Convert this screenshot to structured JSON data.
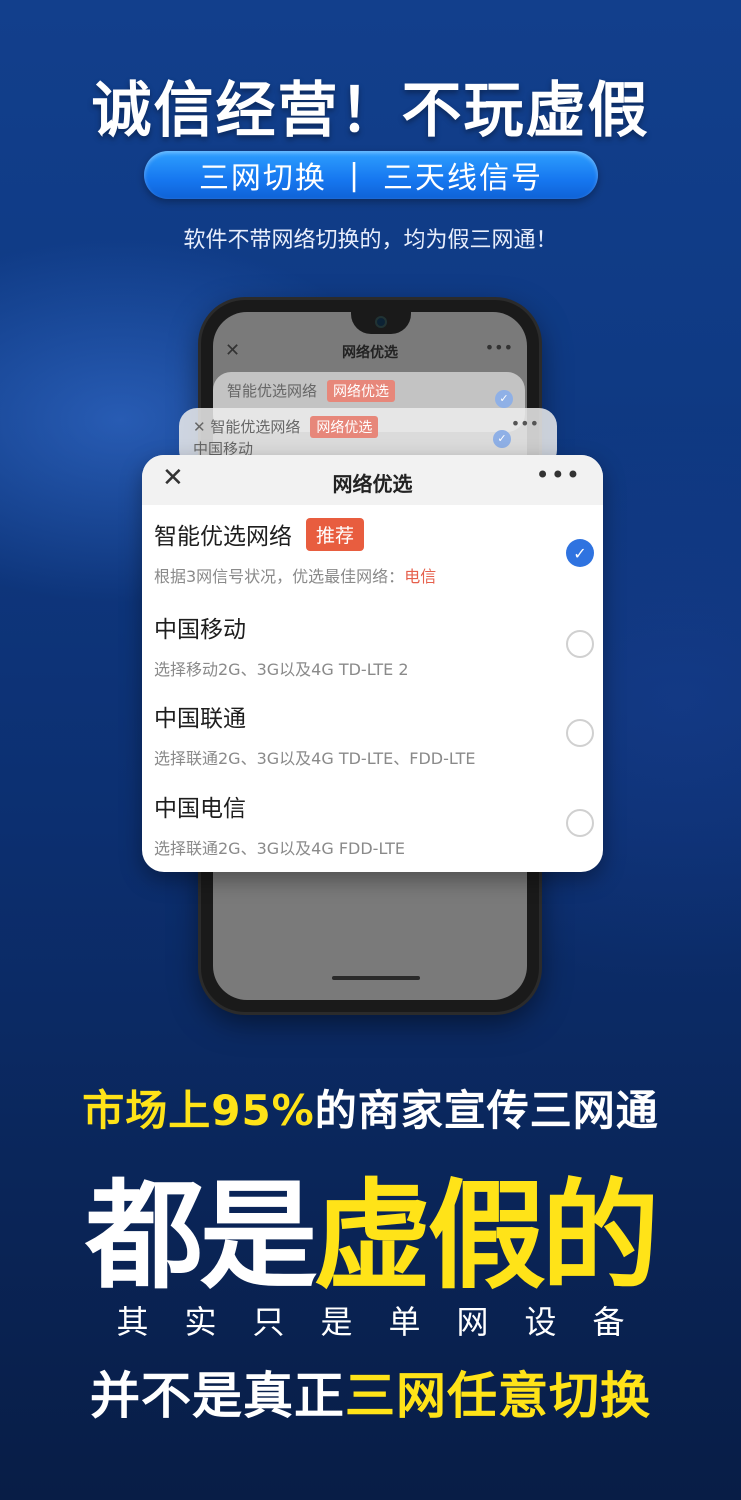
{
  "headline": "诚信经营！不玩虚假",
  "pill": {
    "left": "三网切换",
    "separator": "|",
    "right": "三天线信号"
  },
  "subnote": "软件不带网络切换的，均为假三网通！",
  "phone_screen": {
    "title": "网络优选",
    "close_icon": "close-icon",
    "more_icon": "more-icon"
  },
  "ghost_cards": [
    {
      "line": "智能优选网络",
      "tag": "网络优选"
    },
    {
      "line": "智能优选网络",
      "tag": "网络优选",
      "sub": "中国移动"
    }
  ],
  "card": {
    "title": "网络优选",
    "close": "✕",
    "more": "•••",
    "options": [
      {
        "name": "智能优选网络",
        "badge": "推荐",
        "desc_prefix": "根据3网信号状况，优选最佳网络：",
        "desc_highlight": "电信",
        "selected": true
      },
      {
        "name": "中国移动",
        "desc": "选择移动2G、3G以及4G TD-LTE 2",
        "selected": false
      },
      {
        "name": "中国联通",
        "desc": "选择联通2G、3G以及4G TD-LTE、FDD-LTE",
        "selected": false
      },
      {
        "name": "中国电信",
        "desc": "选择联通2G、3G以及4G FDD-LTE",
        "selected": false
      }
    ]
  },
  "claim": {
    "yellow": "市场上95%",
    "white": "的商家宣传三网通"
  },
  "big": {
    "white": "都是",
    "yellow": "虚假的"
  },
  "spaced": "其实只是单网设备",
  "final": {
    "white": "并不是真正",
    "yellow": "三网任意切换"
  },
  "colors": {
    "accent_yellow": "#ffe318",
    "badge_red": "#e85d3f",
    "check_blue": "#2f73e0",
    "pill_blue": "#1677f0"
  }
}
